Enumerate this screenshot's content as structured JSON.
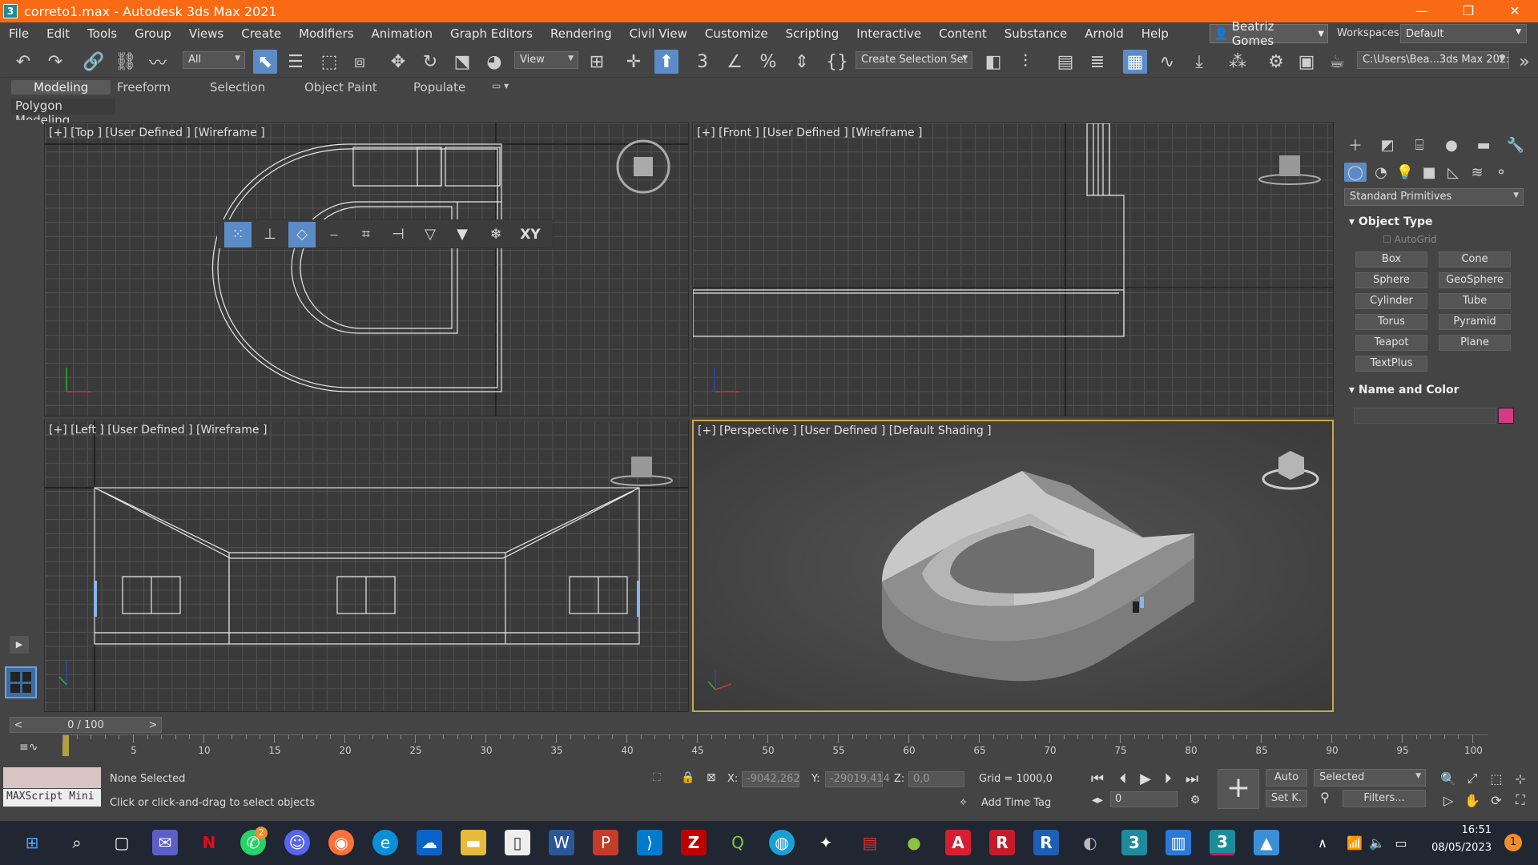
{
  "window": {
    "title": "correto1.max - Autodesk 3ds Max 2021",
    "app_icon": "3",
    "controls": [
      "—",
      "❐",
      "✕"
    ]
  },
  "menu": [
    "File",
    "Edit",
    "Tools",
    "Group",
    "Views",
    "Create",
    "Modifiers",
    "Animation",
    "Graph Editors",
    "Rendering",
    "Civil View",
    "Customize",
    "Scripting",
    "Interactive",
    "Content",
    "Substance",
    "Arnold",
    "Help"
  ],
  "user": {
    "name": "Beatriz Gomes",
    "workspaces_label": "Workspaces:",
    "workspace": "Default"
  },
  "toolbar": {
    "filter": "All",
    "ref_coord": "View",
    "selection_set": "Create Selection Set",
    "path": "C:\\Users\\Bea...3ds Max 202:"
  },
  "ribbon": {
    "tabs": [
      "Modeling",
      "Freeform",
      "Selection",
      "Object Paint",
      "Populate"
    ],
    "panel": "Polygon Modeling"
  },
  "viewports": {
    "top": "[+] [Top ] [User Defined ] [Wireframe ]",
    "front": "[+] [Front ] [User Defined ] [Wireframe ]",
    "left": "[+] [Left ] [User Defined ] [Wireframe ]",
    "perspective": "[+] [Perspective ] [User Defined ] [Default Shading ]"
  },
  "snaps_toolbar": {
    "xy_label": "XY"
  },
  "command_panel": {
    "category": "Standard Primitives",
    "object_type": "Object Type",
    "autogrid": "AutoGrid",
    "buttons": [
      "Box",
      "Cone",
      "Sphere",
      "GeoSphere",
      "Cylinder",
      "Tube",
      "Torus",
      "Pyramid",
      "Teapot",
      "Plane",
      "TextPlus"
    ],
    "name_and_color": "Name and Color",
    "object_color": "#d63a86"
  },
  "timeline": {
    "frame": "0 / 100",
    "ticks": [
      "5",
      "10",
      "15",
      "20",
      "25",
      "30",
      "35",
      "40",
      "45",
      "50",
      "55",
      "60",
      "65",
      "70",
      "75",
      "80",
      "85",
      "90",
      "95",
      "100"
    ]
  },
  "status": {
    "maxscript": "MAXScript Mini",
    "selection": "None Selected",
    "prompt": "Click or click-and-drag to select objects",
    "x_label": "X:",
    "x": "-9042,262",
    "y_label": "Y:",
    "y": "-29019,414",
    "z_label": "Z:",
    "z": "0,0",
    "grid": "Grid = 1000,0",
    "add_time_tag": "Add Time Tag",
    "auto": "Auto",
    "set_key": "Set K.",
    "selected": "Selected",
    "filters": "Filters...",
    "frame_field": "0"
  },
  "taskbar": {
    "time": "16:51",
    "date": "08/05/2023",
    "notification_count": "1",
    "whatsapp_badge": "2"
  }
}
